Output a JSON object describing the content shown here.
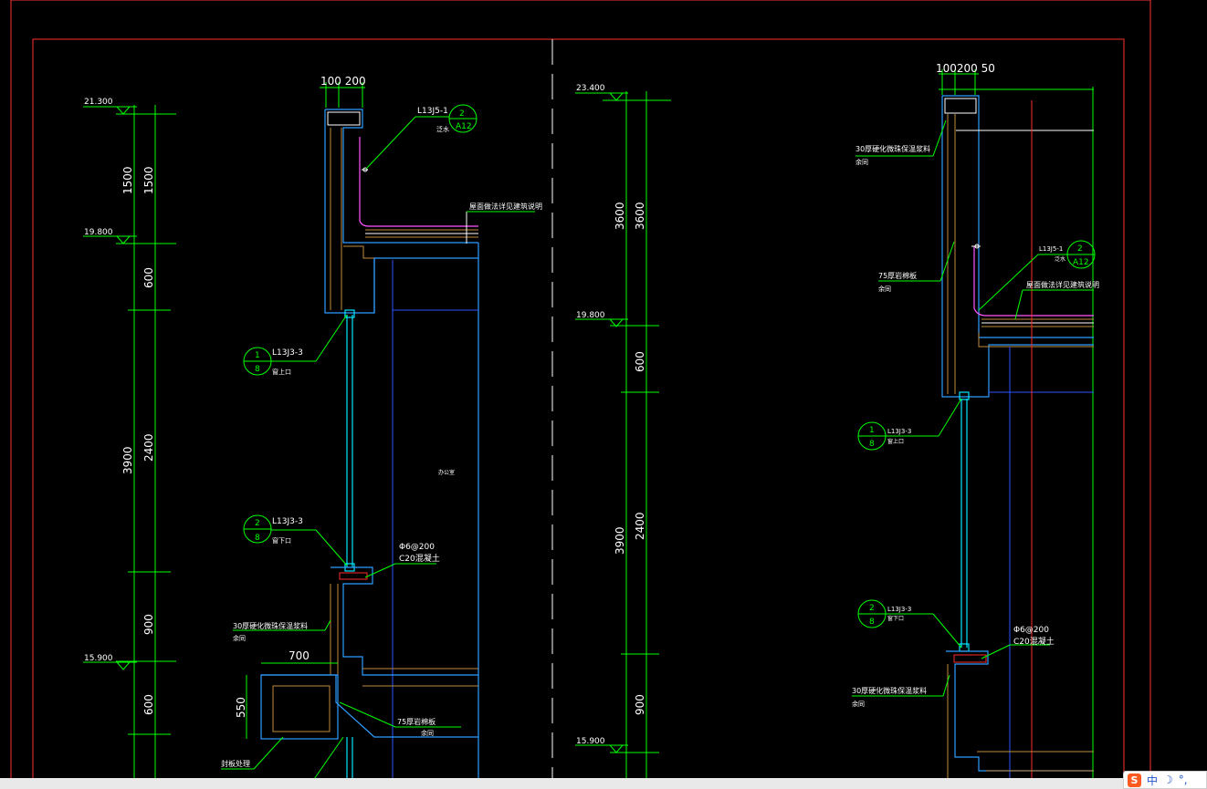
{
  "colors": {
    "background": "#000000",
    "frame": "#ff3030",
    "dimension": "#00ff00",
    "wall": "#2f9dff",
    "glass": "#00e6ff",
    "finish": "#c08a3c",
    "waterproof": "#ff55ff",
    "rebar": "#ff2a2a"
  },
  "left_section": {
    "top_dims": "100 200",
    "levels": [
      "21.300",
      "19.800",
      "15.900"
    ],
    "dims_outer": [
      "3900"
    ],
    "dims_inner": [
      "1500",
      "600",
      "2400",
      "900",
      "600"
    ],
    "dims_outer_top": "1500",
    "callouts": [
      {
        "ref": "L13J5-1",
        "num": "2",
        "sheet": "A12",
        "note": "泛水"
      },
      {
        "ref": "L13J3-3",
        "num": "1",
        "sheet": "8",
        "note": "窗上口"
      },
      {
        "ref": "L13J3-3",
        "num": "2",
        "sheet": "8",
        "note": "窗下口"
      }
    ],
    "roof_note": "屋面做法详见建筑说明",
    "rebar_note": "Φ6@200",
    "concrete_note": "C20混凝土",
    "insulation_note": "30厚硬化微珠保温浆料",
    "insulation_sub": "余同",
    "rock_wool_note": "75厚岩棉板",
    "rock_wool_sub": "余同",
    "sill_note": "封板处理",
    "room_label": "办公室",
    "bay_dims": [
      "700",
      "550"
    ]
  },
  "right_section": {
    "top_dims": "100200 50",
    "levels": [
      "23.400",
      "19.800",
      "15.900"
    ],
    "dims_outer": [
      "3600",
      "3900"
    ],
    "dims_inner": [
      "3600",
      "600",
      "2400",
      "900"
    ],
    "callouts": [
      {
        "ref": "L13J5-1",
        "num": "2",
        "sheet": "A12",
        "note": "泛水"
      },
      {
        "ref": "L13J3-3",
        "num": "1",
        "sheet": "8",
        "note": "窗上口"
      },
      {
        "ref": "L13J3-3",
        "num": "2",
        "sheet": "8",
        "note": "窗下口"
      }
    ],
    "roof_note": "屋面做法详见建筑说明",
    "rebar_note": "Φ6@200",
    "concrete_note": "C20混凝土",
    "insulation_top_note": "30厚硬化微珠保温浆料",
    "insulation_top_sub": "余同",
    "rock_wool_note": "75厚岩棉板",
    "rock_wool_sub": "余同",
    "insulation_note": "30厚硬化微珠保温浆料",
    "insulation_sub": "余同"
  },
  "ime": {
    "logo": "S",
    "lang": "中",
    "moon": "☽",
    "dot": "°,"
  }
}
